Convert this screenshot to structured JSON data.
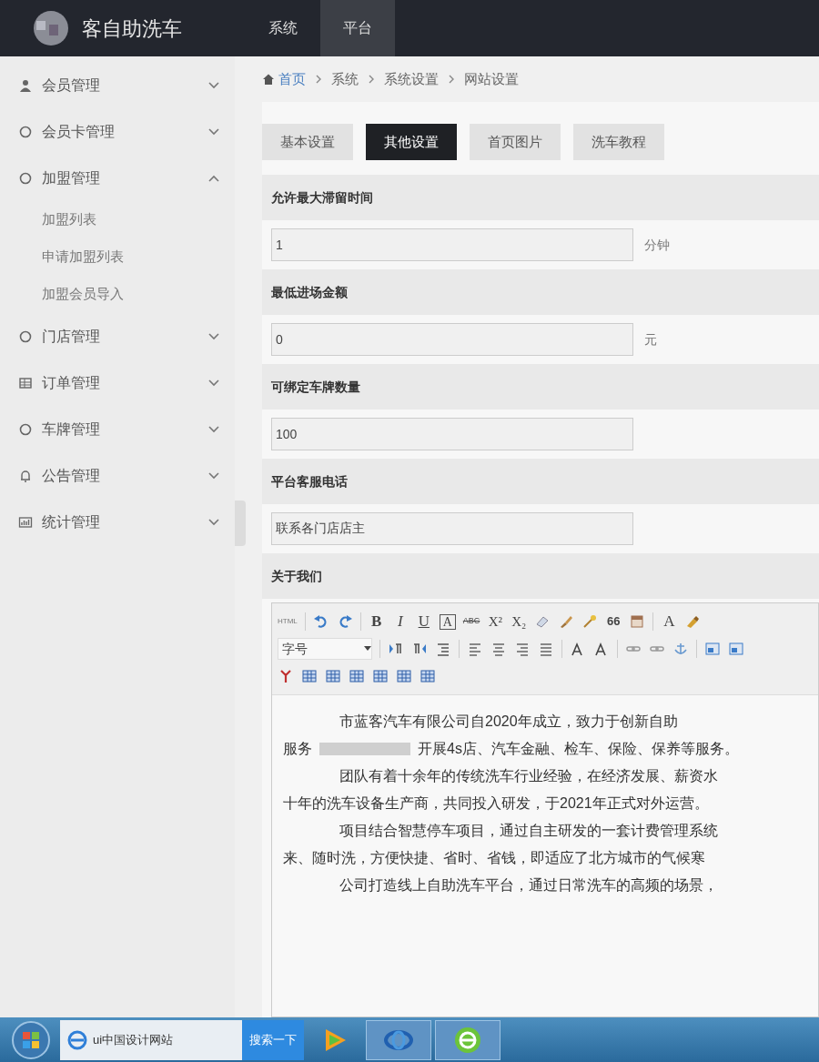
{
  "header": {
    "title": "客自助洗车",
    "nav": [
      {
        "label": "系统",
        "selected": false
      },
      {
        "label": "平台",
        "selected": true
      }
    ]
  },
  "sidebar": {
    "items": [
      {
        "label": "会员管理",
        "expanded": false
      },
      {
        "label": "会员卡管理",
        "expanded": false
      },
      {
        "label": "加盟管理",
        "expanded": true,
        "children": [
          {
            "label": "加盟列表"
          },
          {
            "label": "申请加盟列表"
          },
          {
            "label": "加盟会员导入"
          }
        ]
      },
      {
        "label": "门店管理",
        "expanded": false
      },
      {
        "label": "订单管理",
        "expanded": false
      },
      {
        "label": "车牌管理",
        "expanded": false
      },
      {
        "label": "公告管理",
        "expanded": false
      },
      {
        "label": "统计管理",
        "expanded": false
      }
    ]
  },
  "breadcrumb": [
    "首页",
    "系统",
    "系统设置",
    "网站设置"
  ],
  "tabs": [
    {
      "label": "基本设置",
      "selected": false
    },
    {
      "label": "其他设置",
      "selected": true
    },
    {
      "label": "首页图片",
      "selected": false
    },
    {
      "label": "洗车教程",
      "selected": false
    }
  ],
  "form": {
    "fields": [
      {
        "label": "允许最大滞留时间",
        "value": "1",
        "unit": "分钟"
      },
      {
        "label": "最低进场金额",
        "value": "0",
        "unit": "元"
      },
      {
        "label": "可绑定车牌数量",
        "value": "100"
      },
      {
        "label": "平台客服电话",
        "value": "联系各门店店主"
      }
    ],
    "editor": {
      "label": "关于我们",
      "toolbar_texts": [
        "HTML",
        "B",
        "I",
        "U",
        "A",
        "ABC",
        "X²",
        "X₂",
        "66",
        "A"
      ],
      "font_size_select": "字号",
      "paragraphs": [
        {
          "lines": [
            {
              "text": "市蓝客汽车有限公司自2020年成立，致力于创新自助"
            },
            {
              "text": "服务",
              "suffix": "开展4s店、汽车金融、检车、保险、保养等服务。"
            }
          ]
        },
        {
          "lines": [
            {
              "text": "团队有着十余年的传统洗车行业经验，在经济发展、薪资水"
            },
            {
              "text": "十年的洗车设备生产商，共同投入研发，于2021年正式对外运营。"
            }
          ]
        },
        {
          "lines": [
            {
              "text": "项目结合智慧停车项目，通过自主研发的一套计费管理系统"
            },
            {
              "text": "来、随时洗，方便快捷、省时、省钱，即适应了北方城市的气候寒"
            }
          ]
        },
        {
          "lines": [
            {
              "text": "公司打造线上自助洗车平台，通过日常洗车的高频的场景，"
            }
          ]
        }
      ]
    }
  },
  "taskbar": {
    "browser_tab": "ui中国设计网站",
    "search_button": "搜索一下"
  }
}
